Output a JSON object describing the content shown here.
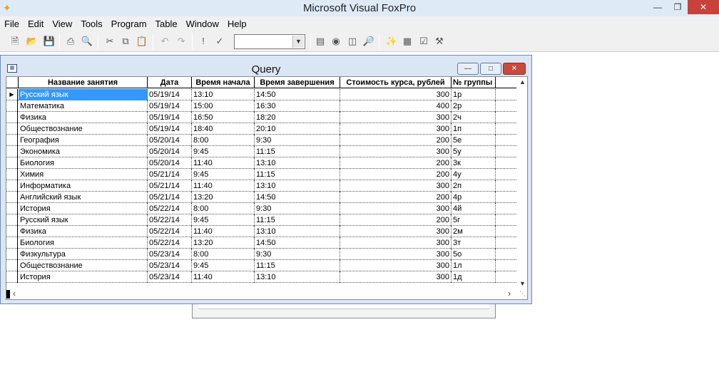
{
  "app": {
    "title": "Microsoft Visual FoxPro",
    "logo_icon": "foxpro-logo-icon",
    "controls": [
      "minimize",
      "maximize",
      "close"
    ]
  },
  "menu": [
    "File",
    "Edit",
    "View",
    "Tools",
    "Program",
    "Table",
    "Window",
    "Help"
  ],
  "toolbar": {
    "icons": [
      "new-icon",
      "open-icon",
      "save-icon",
      "print-icon",
      "print-preview-icon",
      "cut-icon",
      "copy-icon",
      "paste-icon",
      "undo-icon",
      "redo-icon",
      "run-icon",
      "modify-icon",
      "database-combo",
      "command-window-icon",
      "data-session-icon",
      "form-icon",
      "report-icon",
      "wizard-icon",
      "builder-icon",
      "class-icon",
      "tools-icon"
    ],
    "combo_value": ""
  },
  "query_window": {
    "title": "Query",
    "columns": [
      "Название занятия",
      "Дата",
      "Время начала",
      "Время завершения",
      "Стоимость курса, рублей",
      "№ группы"
    ],
    "rows": [
      [
        "Русский язык",
        "05/19/14",
        "13:10",
        "14:50",
        "300",
        "1р"
      ],
      [
        "Математика",
        "05/19/14",
        "15:00",
        "16:30",
        "400",
        "2р"
      ],
      [
        "Физика",
        "05/19/14",
        "16:50",
        "18:20",
        "300",
        "2ч"
      ],
      [
        "Обществознание",
        "05/19/14",
        "18:40",
        "20:10",
        "300",
        "1п"
      ],
      [
        "География",
        "05/20/14",
        "8:00",
        "9:30",
        "200",
        "5е"
      ],
      [
        "Экономика",
        "05/20/14",
        "9:45",
        "11:15",
        "300",
        "5у"
      ],
      [
        "Биология",
        "05/20/14",
        "11:40",
        "13:10",
        "200",
        "3к"
      ],
      [
        "Химия",
        "05/21/14",
        "9:45",
        "11:15",
        "200",
        "4у"
      ],
      [
        "Информатика",
        "05/21/14",
        "11:40",
        "13:10",
        "300",
        "2п"
      ],
      [
        "Английский язык",
        "05/21/14",
        "13:20",
        "14:50",
        "200",
        "4р"
      ],
      [
        "История",
        "05/22/14",
        "8:00",
        "9:30",
        "300",
        "4й"
      ],
      [
        "Русский язык",
        "05/22/14",
        "9:45",
        "11:15",
        "200",
        "5г"
      ],
      [
        "Физика",
        "05/22/14",
        "11:40",
        "13:10",
        "300",
        "2м"
      ],
      [
        "Биология",
        "05/22/14",
        "13:20",
        "14:50",
        "300",
        "3т"
      ],
      [
        "Физкультура",
        "05/23/14",
        "8:00",
        "9:30",
        "300",
        "5о"
      ],
      [
        "Обществознание",
        "05/23/14",
        "9:45",
        "11:15",
        "300",
        "1л"
      ],
      [
        "История",
        "05/23/14",
        "11:40",
        "13:10",
        "300",
        "1д"
      ]
    ],
    "selected_row": 0
  },
  "colors": {
    "selection": "#3399ff",
    "close_button": "#c7433a",
    "window_frame": "#dbe6f4"
  }
}
